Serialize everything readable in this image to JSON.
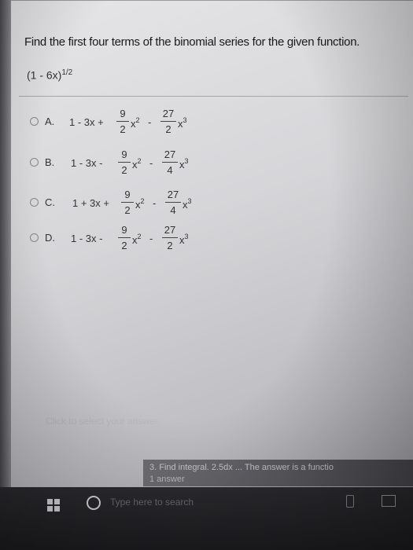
{
  "question": {
    "text": "Find the first four terms of the binomial series for the given function.",
    "function_base": "(1 - 6x)",
    "function_exponent": "1/2"
  },
  "options": [
    {
      "letter": "A.",
      "lead": "1 - 3x +",
      "frac1": {
        "num": "9",
        "den": "2"
      },
      "mid": "x",
      "mid_exp": "2",
      "op": "-",
      "frac2": {
        "num": "27",
        "den": "2"
      },
      "tail": "x",
      "tail_exp": "3"
    },
    {
      "letter": "B.",
      "lead": "1 - 3x -",
      "frac1": {
        "num": "9",
        "den": "2"
      },
      "mid": "x",
      "mid_exp": "2",
      "op": "-",
      "frac2": {
        "num": "27",
        "den": "4"
      },
      "tail": "x",
      "tail_exp": "3"
    },
    {
      "letter": "C.",
      "lead": "1 + 3x +",
      "frac1": {
        "num": "9",
        "den": "2"
      },
      "mid": "x",
      "mid_exp": "2",
      "op": "-",
      "frac2": {
        "num": "27",
        "den": "4"
      },
      "tail": "x",
      "tail_exp": "3"
    },
    {
      "letter": "D.",
      "lead": "1 - 3x -",
      "frac1": {
        "num": "9",
        "den": "2"
      },
      "mid": "x",
      "mid_exp": "2",
      "op": "-",
      "frac2": {
        "num": "27",
        "den": "2"
      },
      "tail": "x",
      "tail_exp": "3"
    }
  ],
  "hint": "Click to select your answer.",
  "next_question": {
    "link": "3. Find integral. 2.5dx ... The answer is a functio",
    "sub": "1 answer"
  },
  "taskbar": {
    "search_placeholder": "Type here to search"
  },
  "colors": {
    "page_bg": "#d8d8db",
    "text": "#333333",
    "taskbar": "#222226"
  }
}
